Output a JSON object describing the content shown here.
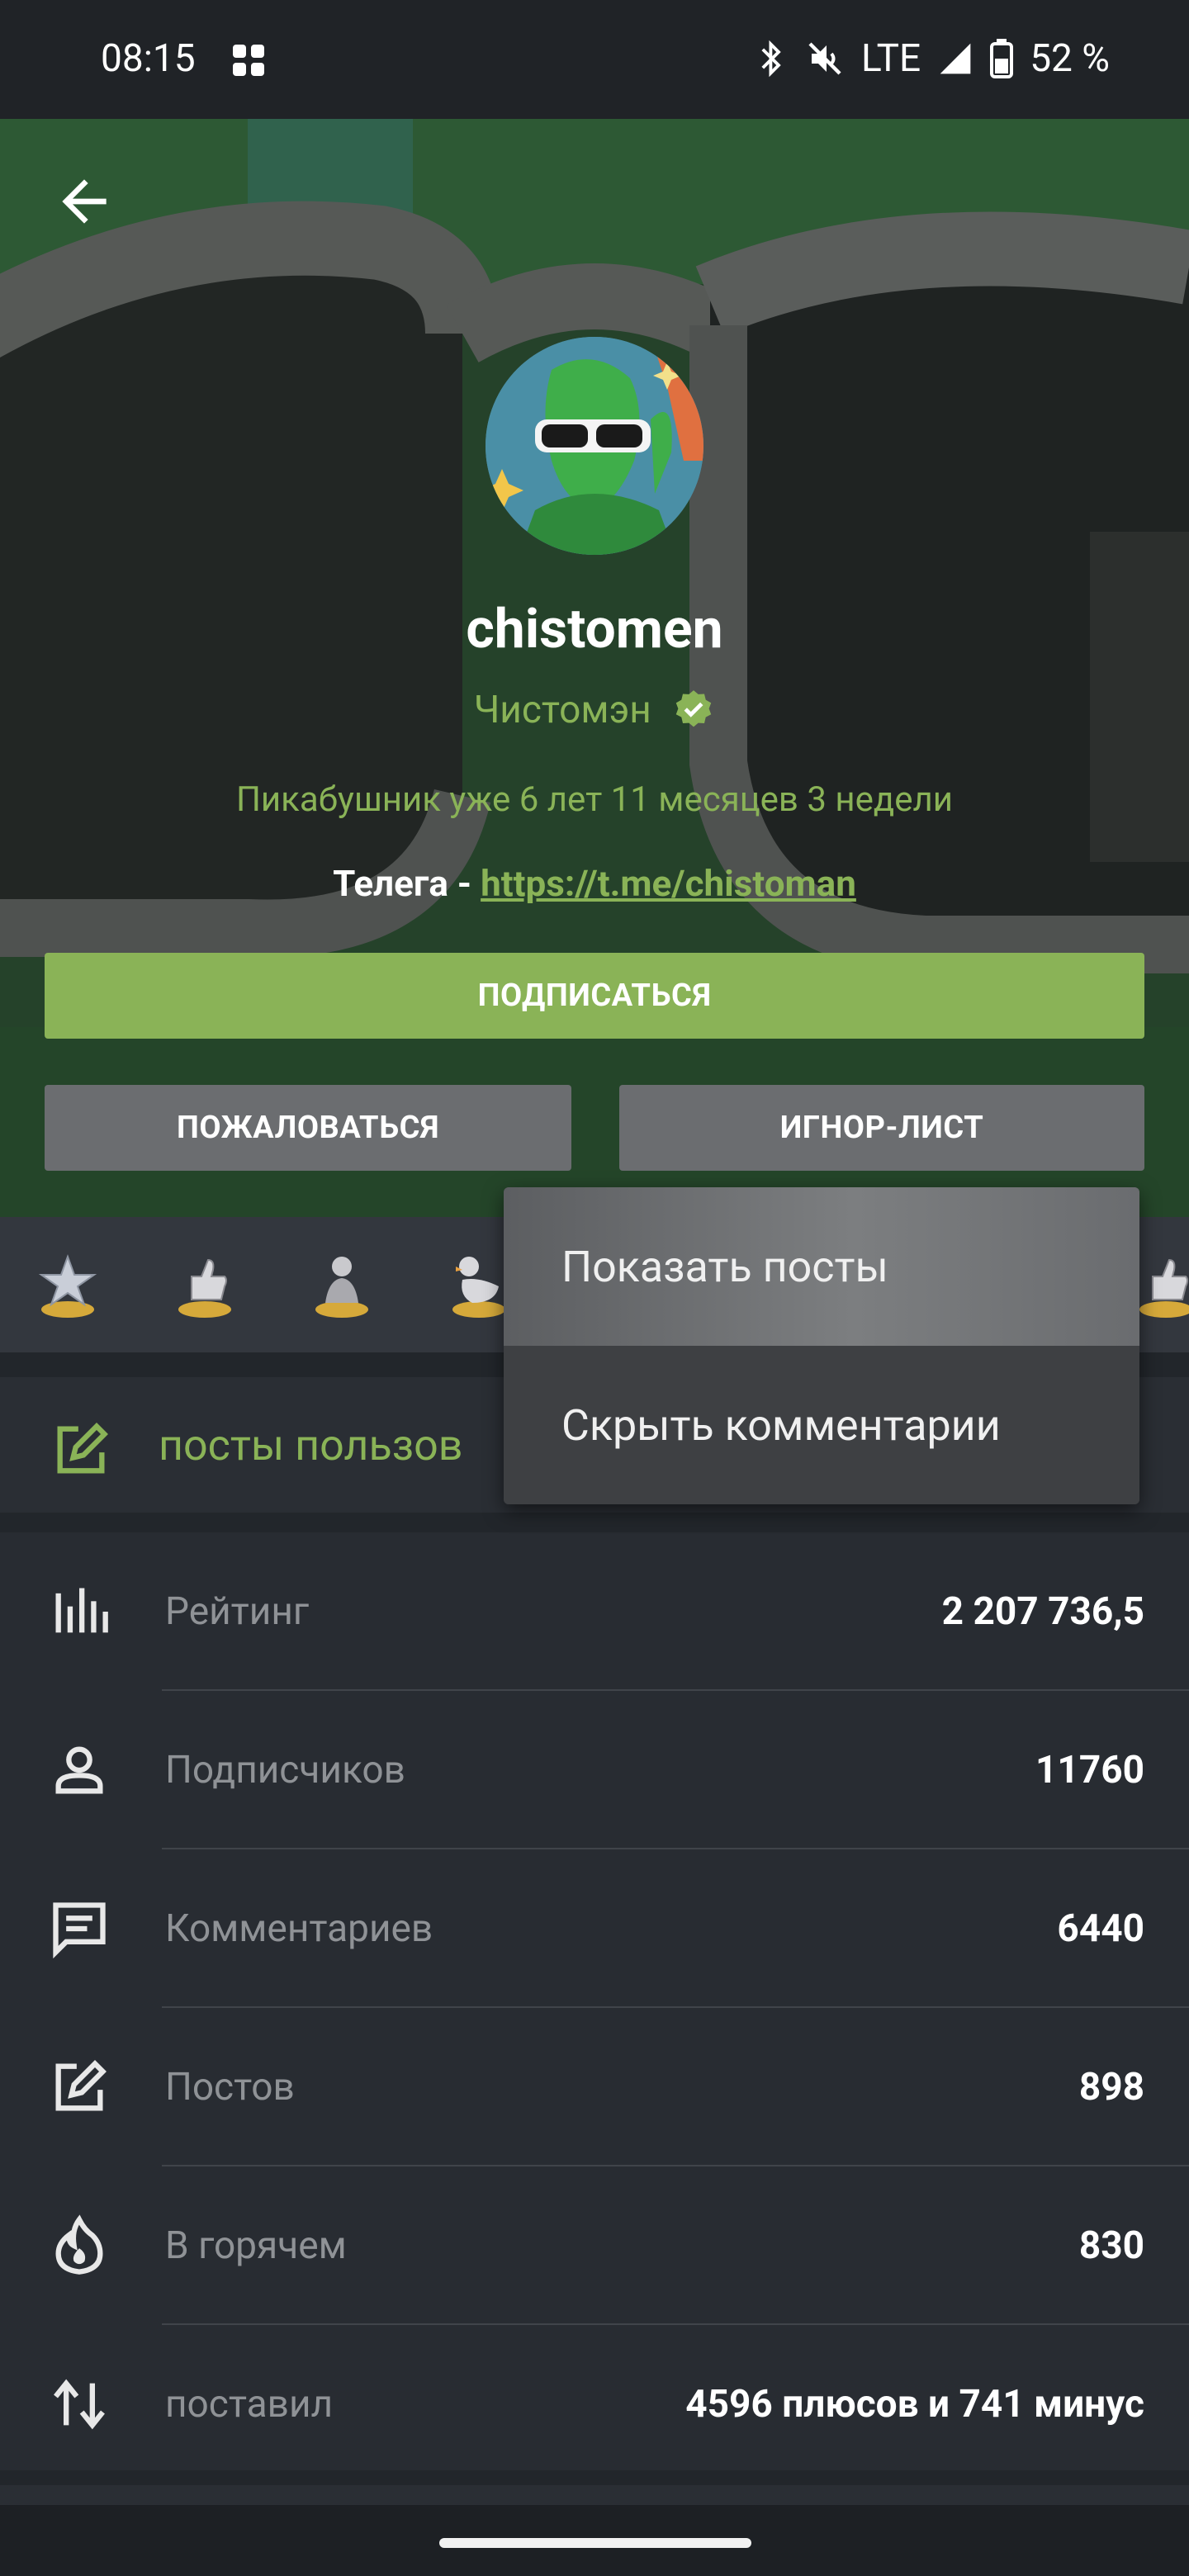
{
  "status_bar": {
    "time": "08:15",
    "network": "LTE",
    "battery": "52 %"
  },
  "profile": {
    "username": "chistomen",
    "display_name": "Чистомэн",
    "tenure": "Пикабушник уже 6 лет 11 месяцев 3 недели",
    "telegram_prefix": "Телега - ",
    "telegram_link": "https://t.me/chistoman"
  },
  "buttons": {
    "subscribe": "ПОДПИСАТЬСЯ",
    "report": "ПОЖАЛОВАТЬСЯ",
    "ignore": "ИГНОР-ЛИСТ"
  },
  "posts_section": {
    "label": "посты пользов"
  },
  "stats": [
    {
      "icon": "bar-chart-icon",
      "label": "Рейтинг",
      "value": "2 207 736,5"
    },
    {
      "icon": "person-icon",
      "label": "Подписчиков",
      "value": "11760"
    },
    {
      "icon": "comment-icon",
      "label": "Комментариев",
      "value": "6440"
    },
    {
      "icon": "edit-icon",
      "label": "Постов",
      "value": "898"
    },
    {
      "icon": "flame-icon",
      "label": "В горячем",
      "value": "830"
    },
    {
      "icon": "swap-vertical-icon",
      "label": "поставил",
      "value": "4596 плюсов и 741 минус"
    }
  ],
  "menu": {
    "items": [
      "Показать посты",
      "Скрыть комментарии"
    ]
  },
  "colors": {
    "accent": "#8ab357",
    "background": "#22262b",
    "button_gray": "#6b6d70",
    "menu": "#3d3f42"
  }
}
